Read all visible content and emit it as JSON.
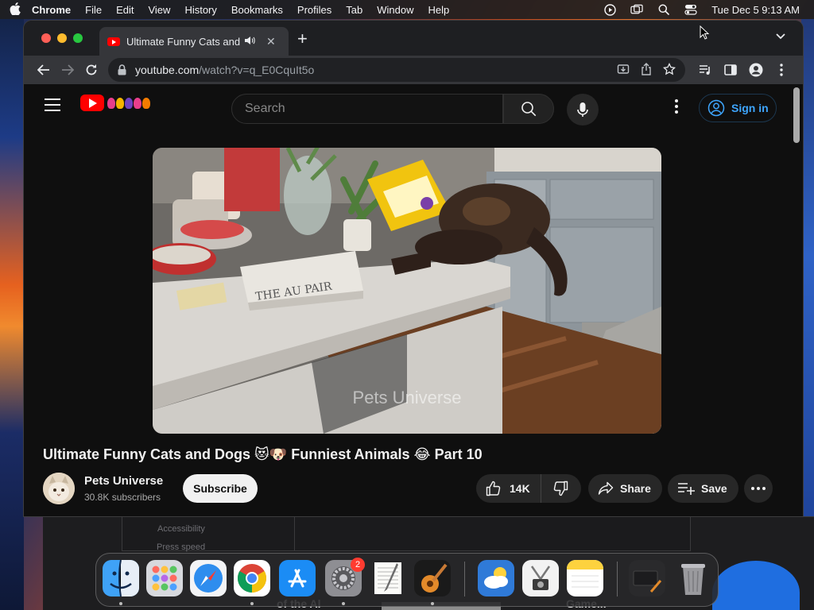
{
  "menubar": {
    "app": "Chrome",
    "items": [
      "File",
      "Edit",
      "View",
      "History",
      "Bookmarks",
      "Profiles",
      "Tab",
      "Window",
      "Help"
    ],
    "clock": "Tue Dec 5  9:13 AM"
  },
  "browser": {
    "tab_title": "Ultimate Funny Cats and D",
    "url_host": "youtube.com",
    "url_path": "/watch?v=q_E0CquIt5o"
  },
  "youtube": {
    "search_placeholder": "Search",
    "sign_in_label": "Sign in",
    "video": {
      "watermark": "Pets Universe",
      "title": "Ultimate Funny Cats and Dogs 😻🐶 Funniest Animals 😂 Part 10",
      "box_text": "THE AU PAIR"
    },
    "channel": {
      "name": "Pets Universe",
      "subscribers": "30.8K subscribers",
      "subscribe_label": "Subscribe"
    },
    "actions": {
      "likes": "14K",
      "share_label": "Share",
      "save_label": "Save"
    }
  },
  "background_window": {
    "line1": "Accessibility",
    "line2": "Press speed",
    "caption1": "of the Al",
    "caption2": "Game..."
  },
  "dock": {
    "apps": [
      "Finder",
      "Launchpad",
      "Safari",
      "Chrome",
      "App Store",
      "System Settings",
      "TextEdit",
      "GarageBand",
      "Weather",
      "Screenshot",
      "Notes",
      "Preview",
      "Trash"
    ],
    "settings_badge": "2"
  },
  "colors": {
    "yt_red": "#ff0000",
    "link_blue": "#3ea6ff",
    "page_bg": "#0f0f0f"
  }
}
